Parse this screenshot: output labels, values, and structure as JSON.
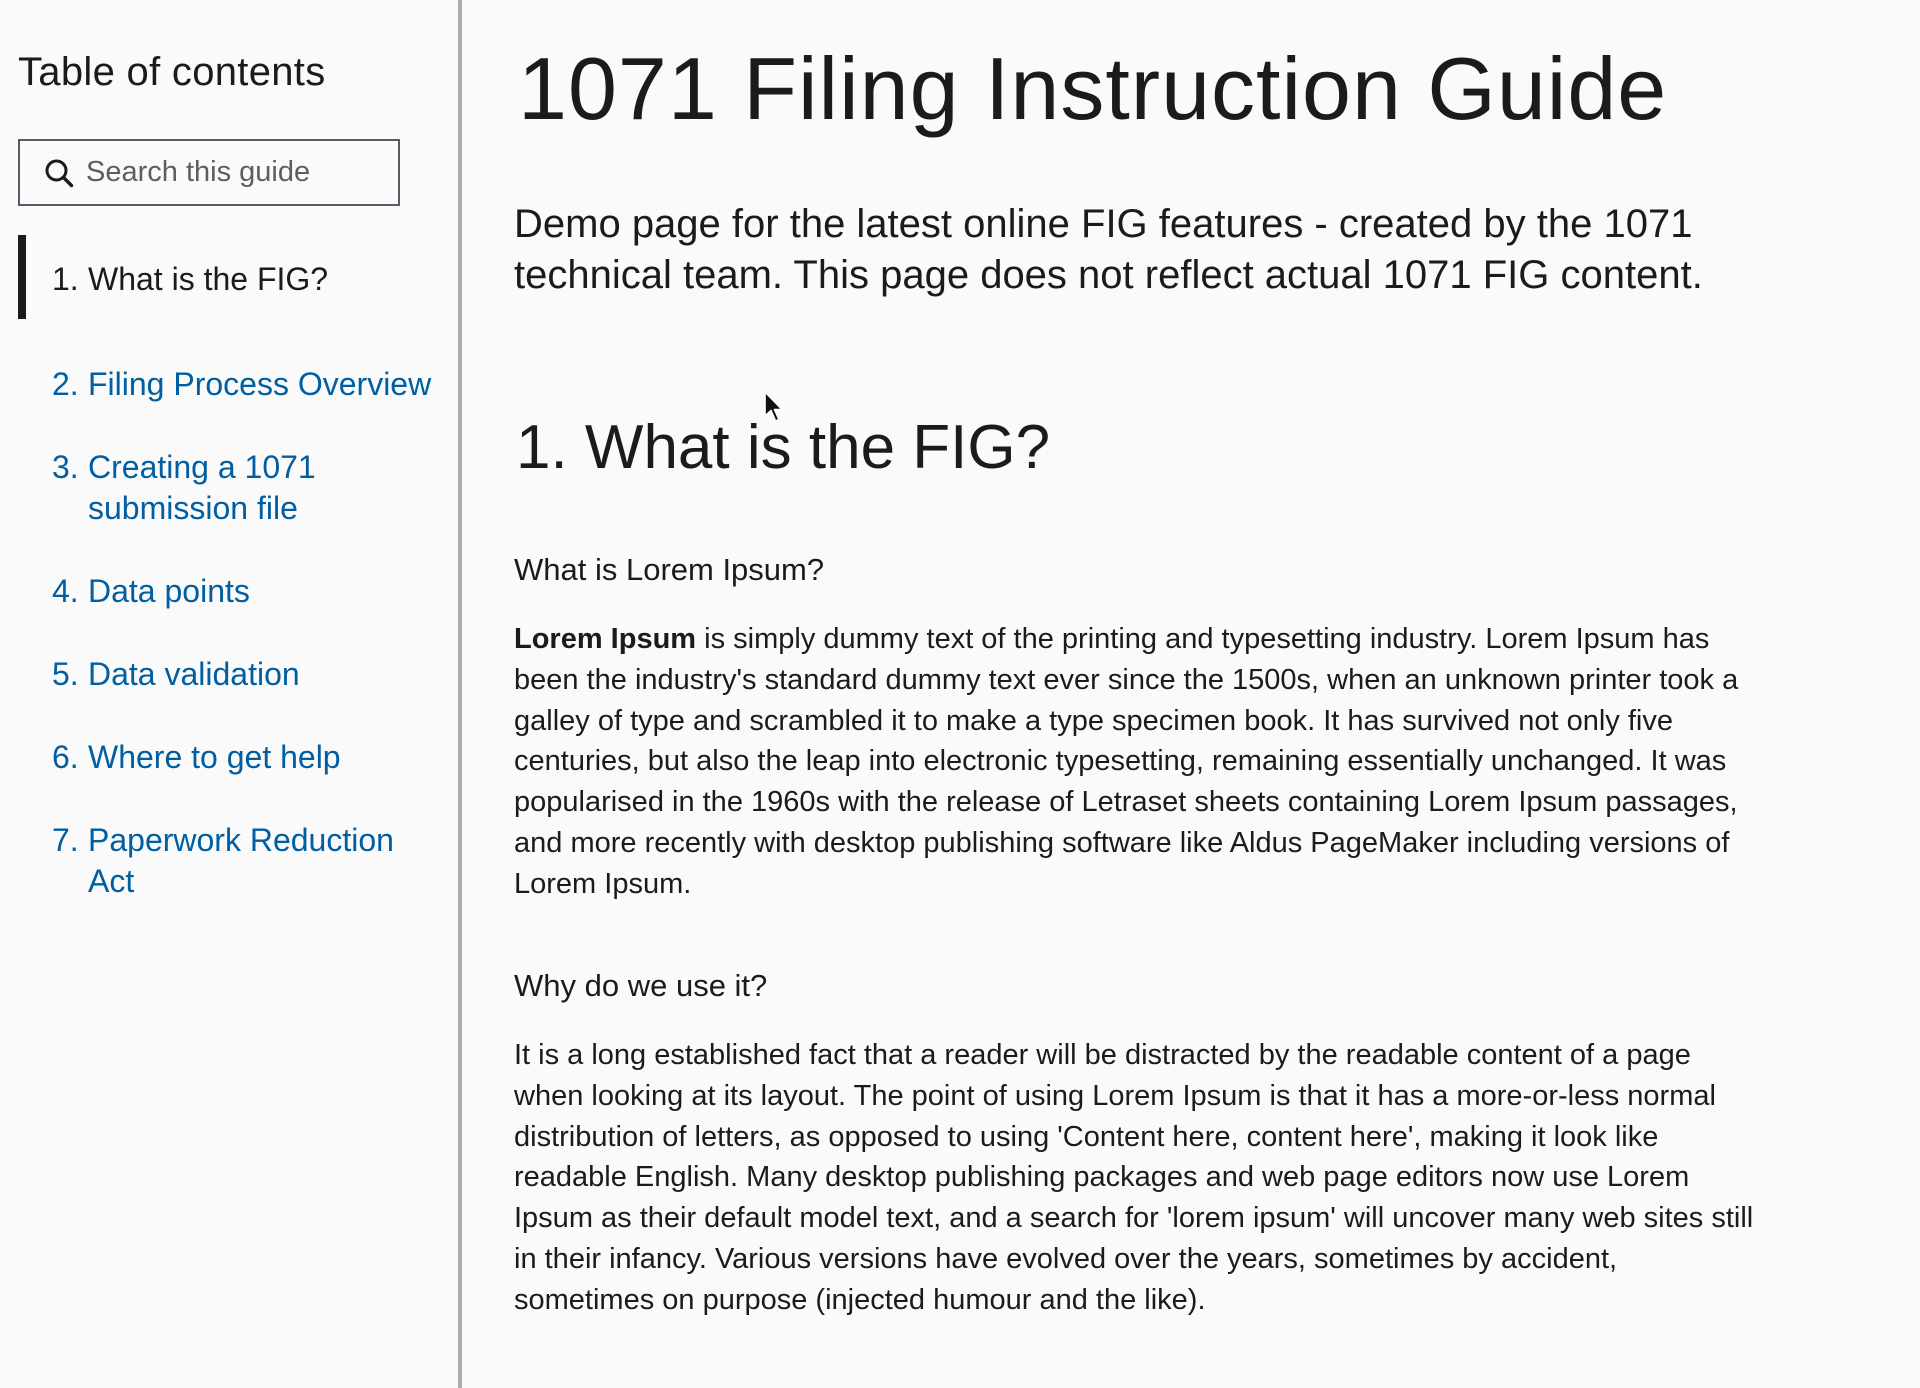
{
  "sidebar": {
    "toc_title": "Table of contents",
    "search": {
      "placeholder": "Search this guide",
      "icon": "search-icon"
    },
    "items": [
      {
        "num": "1.",
        "label": "What is the FIG?",
        "active": true
      },
      {
        "num": "2.",
        "label": "Filing Process Overview",
        "active": false
      },
      {
        "num": "3.",
        "label": "Creating a 1071 submission file",
        "active": false
      },
      {
        "num": "4.",
        "label": "Data points",
        "active": false
      },
      {
        "num": "5.",
        "label": "Data validation",
        "active": false
      },
      {
        "num": "6.",
        "label": "Where to get help",
        "active": false
      },
      {
        "num": "7.",
        "label": "Paperwork Reduction Act",
        "active": false
      }
    ]
  },
  "main": {
    "title": "1071 Filing Instruction Guide",
    "intro": "Demo page for the latest online FIG features - created by the 1071 technical team. This page does not reflect actual 1071 FIG content.",
    "section": {
      "heading": "1. What is the FIG?",
      "subsections": [
        {
          "heading": "What is Lorem Ipsum?",
          "lead_bold": "Lorem Ipsum",
          "text": " is simply dummy text of the printing and typesetting industry. Lorem Ipsum has been the industry's standard dummy text ever since the 1500s, when an unknown printer took a galley of type and scrambled it to make a type specimen book. It has survived not only five centuries, but also the leap into electronic typesetting, remaining essentially unchanged. It was popularised in the 1960s with the release of Letraset sheets containing Lorem Ipsum passages, and more recently with desktop publishing software like Aldus PageMaker including versions of Lorem Ipsum."
        },
        {
          "heading": "Why do we use it?",
          "text": "It is a long established fact that a reader will be distracted by the readable content of a page when looking at its layout. The point of using Lorem Ipsum is that it has a more-or-less normal distribution of letters, as opposed to using 'Content here, content here', making it look like readable English. Many desktop publishing packages and web page editors now use Lorem Ipsum as their default model text, and a search for 'lorem ipsum' will uncover many web sites still in their infancy. Various versions have evolved over the years, sometimes by accident, sometimes on purpose (injected humour and the like)."
        }
      ]
    }
  },
  "colors": {
    "link": "#005ea2",
    "text": "#1b1b1b",
    "background": "#fafafa",
    "divider": "#a9aeb1"
  }
}
